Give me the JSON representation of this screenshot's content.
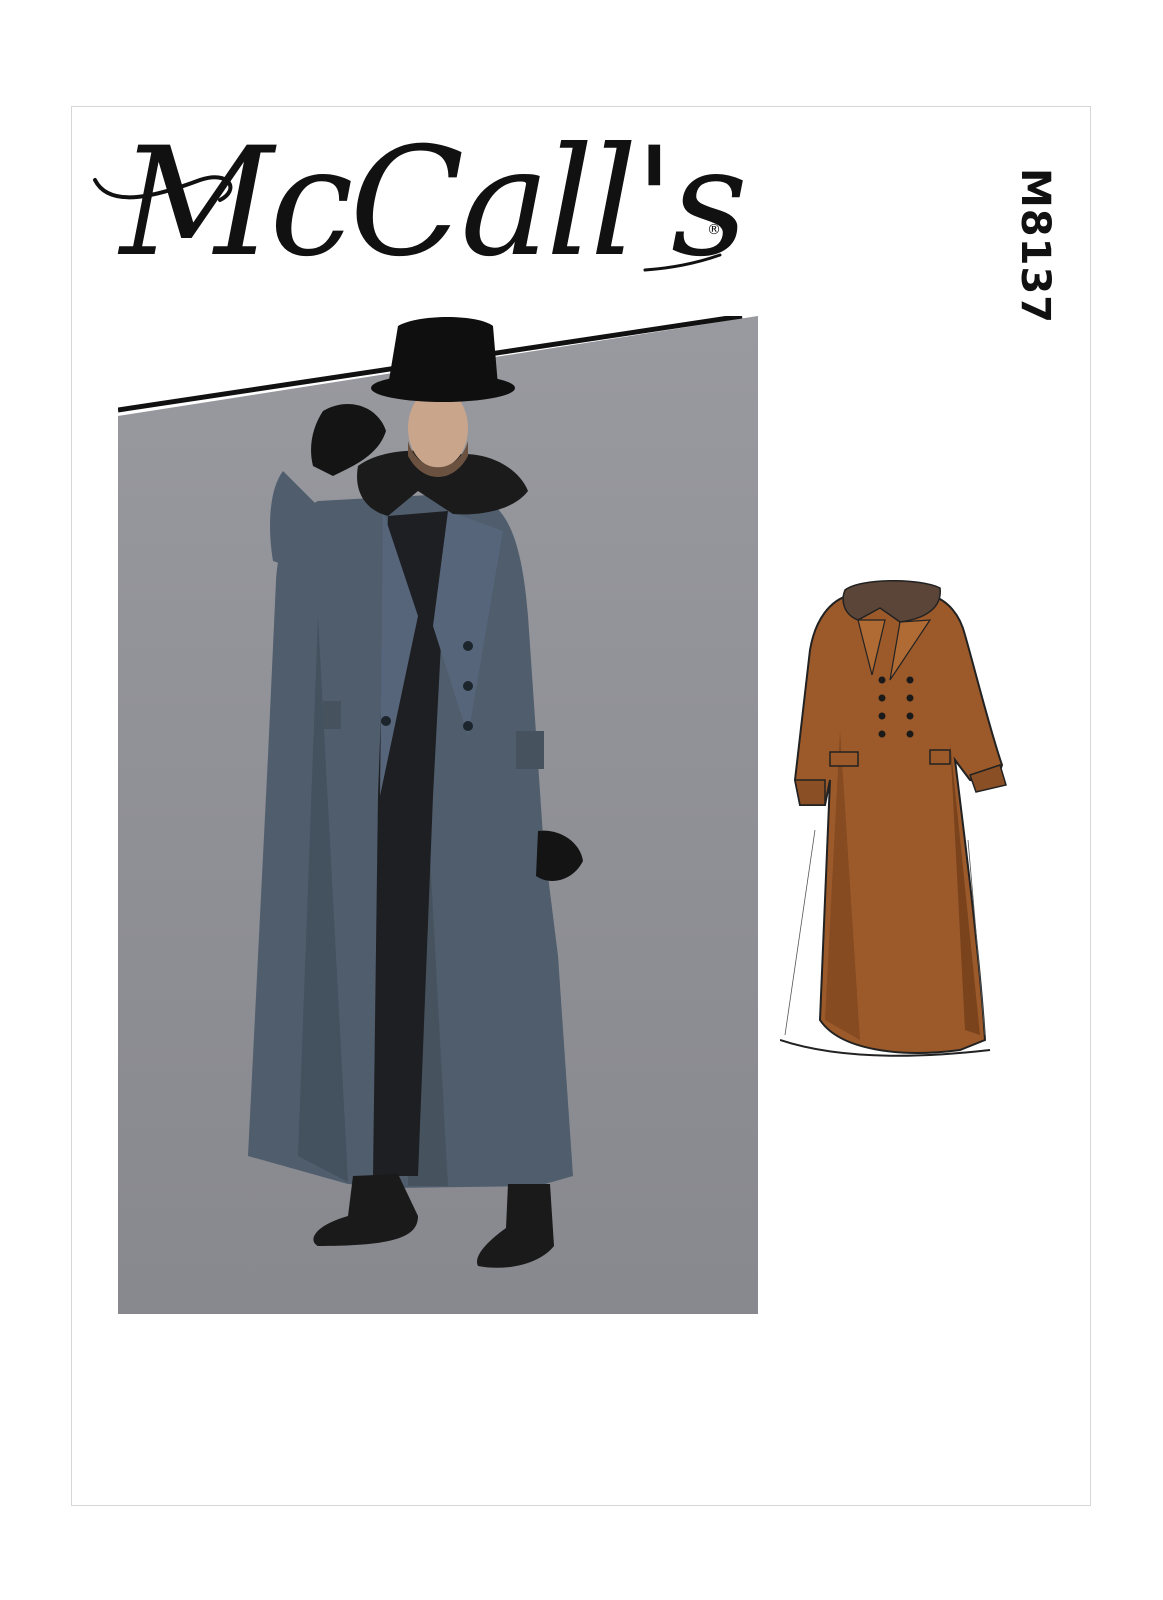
{
  "brand": {
    "name": "McCall's",
    "registered_mark": "®"
  },
  "pattern_code": "M8137",
  "colors": {
    "photo_background": "#8f9096",
    "coat_blue_gray": "#4f5d6d",
    "sketch_coat_brown": "#9c5a2a",
    "collar_fur_black": "#1b1b1b"
  },
  "icons": {
    "photo": "model-in-long-coat-and-top-hat",
    "sketch": "double-breasted-coat-fashion-sketch"
  }
}
